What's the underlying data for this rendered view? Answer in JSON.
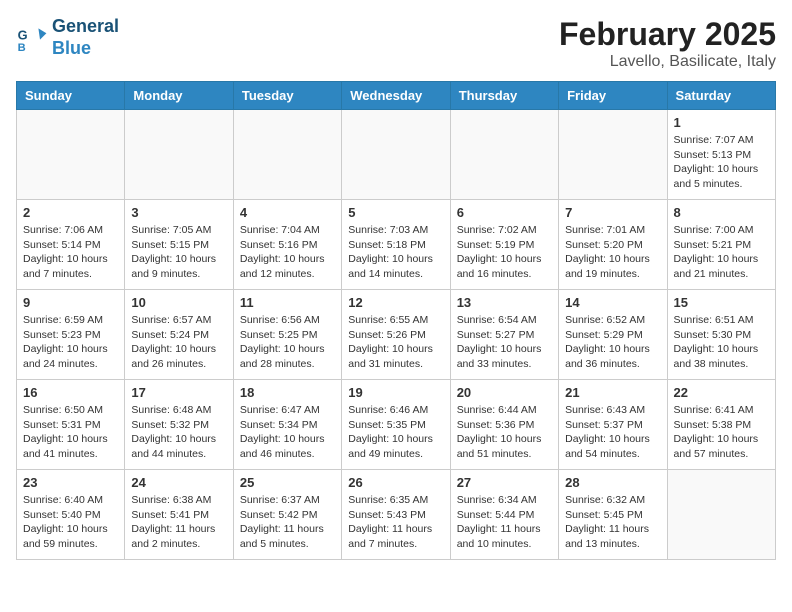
{
  "header": {
    "logo_line1": "General",
    "logo_line2": "Blue",
    "month": "February 2025",
    "location": "Lavello, Basilicate, Italy"
  },
  "weekdays": [
    "Sunday",
    "Monday",
    "Tuesday",
    "Wednesday",
    "Thursday",
    "Friday",
    "Saturday"
  ],
  "weeks": [
    [
      {
        "day": "",
        "info": ""
      },
      {
        "day": "",
        "info": ""
      },
      {
        "day": "",
        "info": ""
      },
      {
        "day": "",
        "info": ""
      },
      {
        "day": "",
        "info": ""
      },
      {
        "day": "",
        "info": ""
      },
      {
        "day": "1",
        "info": "Sunrise: 7:07 AM\nSunset: 5:13 PM\nDaylight: 10 hours and 5 minutes."
      }
    ],
    [
      {
        "day": "2",
        "info": "Sunrise: 7:06 AM\nSunset: 5:14 PM\nDaylight: 10 hours and 7 minutes."
      },
      {
        "day": "3",
        "info": "Sunrise: 7:05 AM\nSunset: 5:15 PM\nDaylight: 10 hours and 9 minutes."
      },
      {
        "day": "4",
        "info": "Sunrise: 7:04 AM\nSunset: 5:16 PM\nDaylight: 10 hours and 12 minutes."
      },
      {
        "day": "5",
        "info": "Sunrise: 7:03 AM\nSunset: 5:18 PM\nDaylight: 10 hours and 14 minutes."
      },
      {
        "day": "6",
        "info": "Sunrise: 7:02 AM\nSunset: 5:19 PM\nDaylight: 10 hours and 16 minutes."
      },
      {
        "day": "7",
        "info": "Sunrise: 7:01 AM\nSunset: 5:20 PM\nDaylight: 10 hours and 19 minutes."
      },
      {
        "day": "8",
        "info": "Sunrise: 7:00 AM\nSunset: 5:21 PM\nDaylight: 10 hours and 21 minutes."
      }
    ],
    [
      {
        "day": "9",
        "info": "Sunrise: 6:59 AM\nSunset: 5:23 PM\nDaylight: 10 hours and 24 minutes."
      },
      {
        "day": "10",
        "info": "Sunrise: 6:57 AM\nSunset: 5:24 PM\nDaylight: 10 hours and 26 minutes."
      },
      {
        "day": "11",
        "info": "Sunrise: 6:56 AM\nSunset: 5:25 PM\nDaylight: 10 hours and 28 minutes."
      },
      {
        "day": "12",
        "info": "Sunrise: 6:55 AM\nSunset: 5:26 PM\nDaylight: 10 hours and 31 minutes."
      },
      {
        "day": "13",
        "info": "Sunrise: 6:54 AM\nSunset: 5:27 PM\nDaylight: 10 hours and 33 minutes."
      },
      {
        "day": "14",
        "info": "Sunrise: 6:52 AM\nSunset: 5:29 PM\nDaylight: 10 hours and 36 minutes."
      },
      {
        "day": "15",
        "info": "Sunrise: 6:51 AM\nSunset: 5:30 PM\nDaylight: 10 hours and 38 minutes."
      }
    ],
    [
      {
        "day": "16",
        "info": "Sunrise: 6:50 AM\nSunset: 5:31 PM\nDaylight: 10 hours and 41 minutes."
      },
      {
        "day": "17",
        "info": "Sunrise: 6:48 AM\nSunset: 5:32 PM\nDaylight: 10 hours and 44 minutes."
      },
      {
        "day": "18",
        "info": "Sunrise: 6:47 AM\nSunset: 5:34 PM\nDaylight: 10 hours and 46 minutes."
      },
      {
        "day": "19",
        "info": "Sunrise: 6:46 AM\nSunset: 5:35 PM\nDaylight: 10 hours and 49 minutes."
      },
      {
        "day": "20",
        "info": "Sunrise: 6:44 AM\nSunset: 5:36 PM\nDaylight: 10 hours and 51 minutes."
      },
      {
        "day": "21",
        "info": "Sunrise: 6:43 AM\nSunset: 5:37 PM\nDaylight: 10 hours and 54 minutes."
      },
      {
        "day": "22",
        "info": "Sunrise: 6:41 AM\nSunset: 5:38 PM\nDaylight: 10 hours and 57 minutes."
      }
    ],
    [
      {
        "day": "23",
        "info": "Sunrise: 6:40 AM\nSunset: 5:40 PM\nDaylight: 10 hours and 59 minutes."
      },
      {
        "day": "24",
        "info": "Sunrise: 6:38 AM\nSunset: 5:41 PM\nDaylight: 11 hours and 2 minutes."
      },
      {
        "day": "25",
        "info": "Sunrise: 6:37 AM\nSunset: 5:42 PM\nDaylight: 11 hours and 5 minutes."
      },
      {
        "day": "26",
        "info": "Sunrise: 6:35 AM\nSunset: 5:43 PM\nDaylight: 11 hours and 7 minutes."
      },
      {
        "day": "27",
        "info": "Sunrise: 6:34 AM\nSunset: 5:44 PM\nDaylight: 11 hours and 10 minutes."
      },
      {
        "day": "28",
        "info": "Sunrise: 6:32 AM\nSunset: 5:45 PM\nDaylight: 11 hours and 13 minutes."
      },
      {
        "day": "",
        "info": ""
      }
    ]
  ]
}
